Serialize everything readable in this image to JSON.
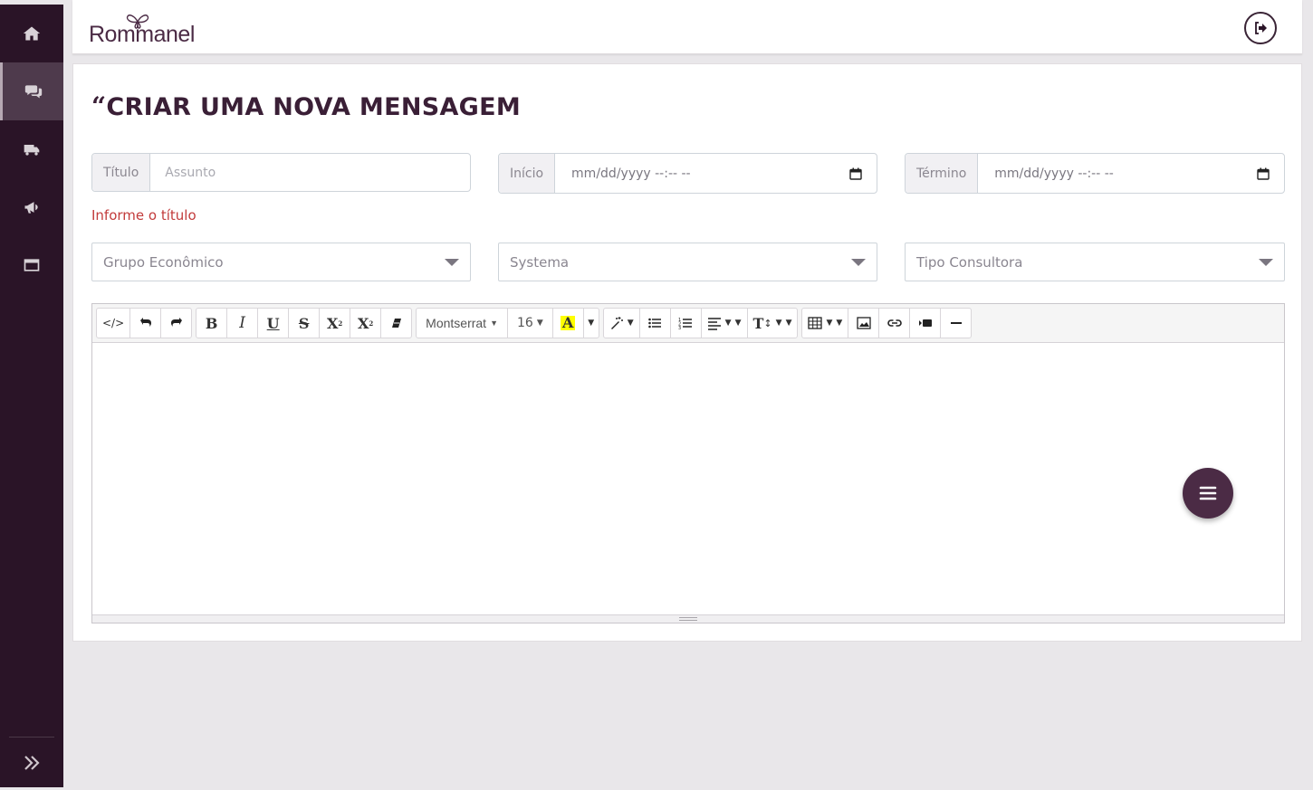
{
  "brand": {
    "logo_text": "Rommanel"
  },
  "sidebar": {
    "items": [
      {
        "icon": "home-icon",
        "active": false
      },
      {
        "icon": "chat-icon",
        "active": true
      },
      {
        "icon": "truck-icon",
        "active": false
      },
      {
        "icon": "megaphone-icon",
        "active": false
      },
      {
        "icon": "window-icon",
        "active": false
      }
    ],
    "expand_icon": "double-chevron-right-icon"
  },
  "header": {
    "logout_icon": "logout-icon"
  },
  "page": {
    "title_quote": "“",
    "title": "CRIAR UMA NOVA MENSAGEM"
  },
  "form": {
    "titulo": {
      "label": "Título",
      "placeholder": "Assunto"
    },
    "inicio": {
      "label": "Início",
      "value": "mm/dd/yyyy --:-- --"
    },
    "termino": {
      "label": "Término",
      "value": "mm/dd/yyyy --:-- --"
    },
    "error": "Informe o título",
    "selects": {
      "grupo": "Grupo Econômico",
      "systema": "Systema",
      "tipo": "Tipo Consultora"
    }
  },
  "editor": {
    "toolbar": {
      "code": "</>",
      "bold": "B",
      "italic": "I",
      "underline": "U",
      "strike": "S",
      "superscript": "X",
      "subscript": "X",
      "font_name": "Montserrat",
      "font_size": "16",
      "color_letter": "A",
      "highlight_color": "#ffff00",
      "text_height": "T"
    }
  },
  "fab_icon": "menu-icon",
  "colors": {
    "sidebar_bg": "#2a1427",
    "accent": "#4b2b45",
    "error": "#c23b3b"
  }
}
